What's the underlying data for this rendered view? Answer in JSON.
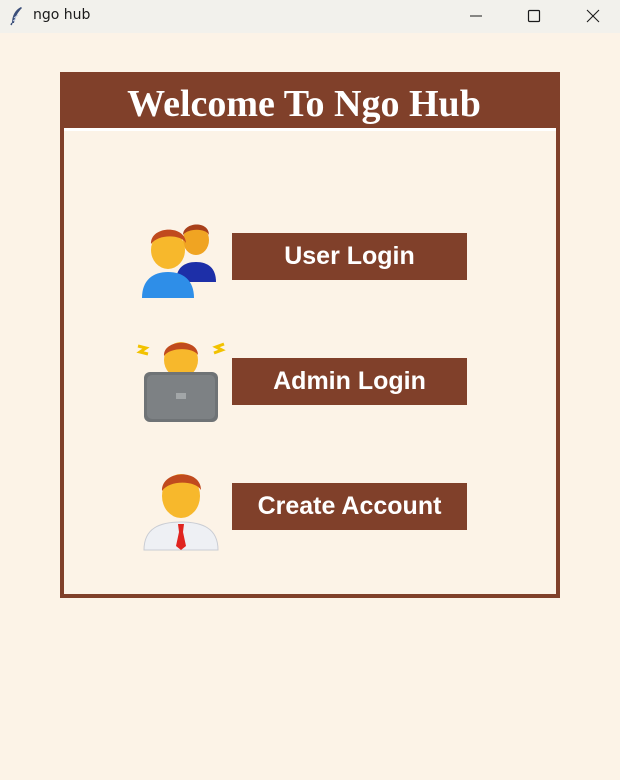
{
  "window": {
    "title": "ngo hub",
    "icons": [
      "feather-icon",
      "minimize-icon",
      "maximize-icon",
      "close-icon"
    ]
  },
  "header": {
    "title": "Welcome To Ngo Hub"
  },
  "actions": [
    {
      "label": "User Login",
      "icon": "users-icon"
    },
    {
      "label": "Admin Login",
      "icon": "admin-laptop-icon"
    },
    {
      "label": "Create Account",
      "icon": "businessman-icon"
    }
  ],
  "colors": {
    "background": "#fcf3e7",
    "accent": "#80402a",
    "button_text": "#ffffff"
  }
}
